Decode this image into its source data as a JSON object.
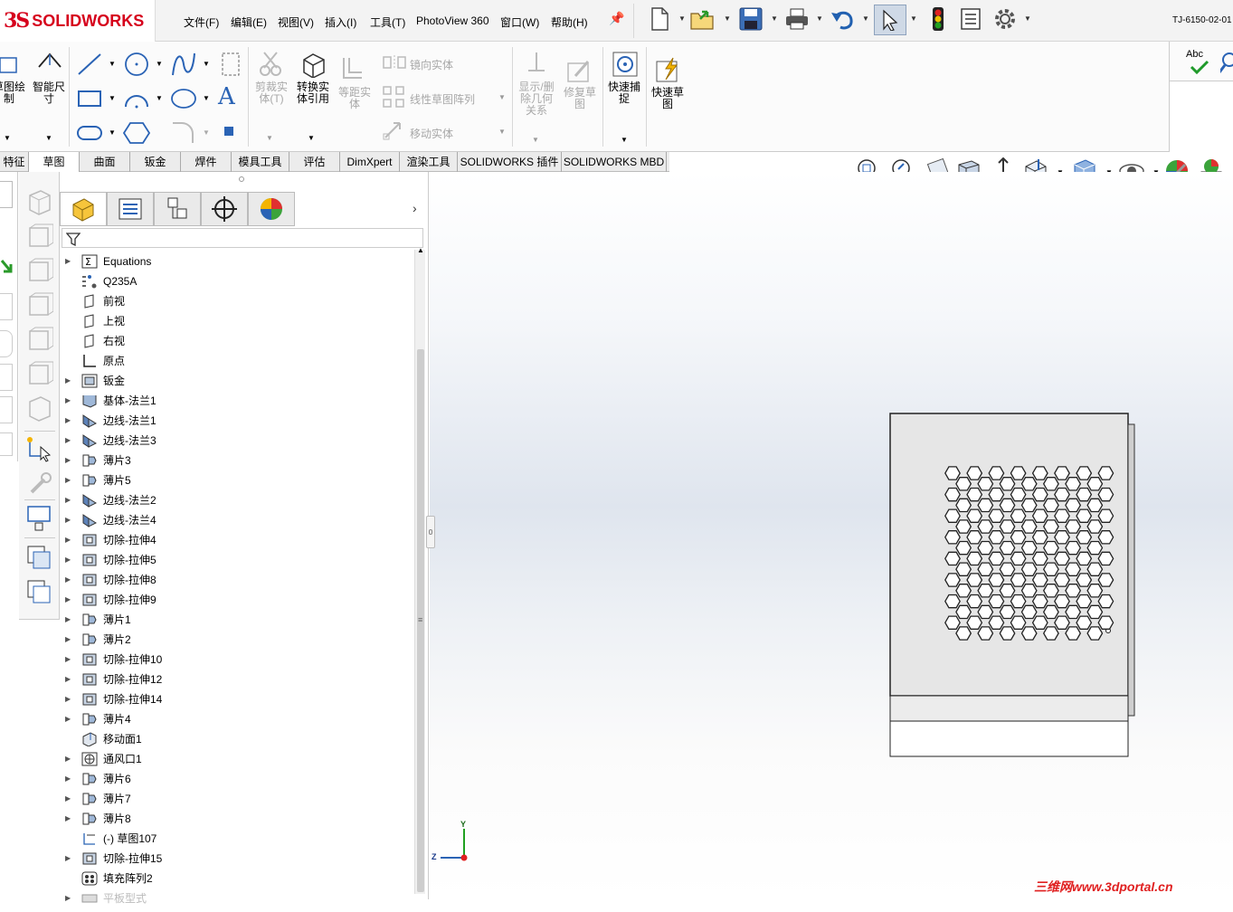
{
  "app": {
    "logo_prefix": "3S",
    "logo_name": "SOLIDWORKS",
    "document_title": "TJ-6150-02-01",
    "accent": "#d6001c"
  },
  "menu": [
    "文件(F)",
    "编辑(E)",
    "视图(V)",
    "插入(I)",
    "工具(T)",
    "PhotoView 360",
    "窗口(W)",
    "帮助(H)"
  ],
  "ribbon": {
    "sketch_draw": "草图绘制",
    "smart_dim": "智能尺寸",
    "trim": "剪裁实体(T)",
    "convert": "转换实体引用",
    "offset": "等距实体",
    "mirror": "镜向实体",
    "linear_pattern": "线性草图阵列",
    "move": "移动实体",
    "show_relations": "显示/删除几何关系",
    "repair": "修复草图",
    "quick_snap": "快速捕捉",
    "rapid_sketch": "快速草图",
    "abc": "Abc"
  },
  "tabs": [
    "特征",
    "草图",
    "曲面",
    "钣金",
    "焊件",
    "模具工具",
    "评估",
    "DimXpert",
    "渲染工具",
    "SOLIDWORKS 插件",
    "SOLIDWORKS MBD"
  ],
  "tree": [
    {
      "label": "Equations",
      "expand": true,
      "icon": "equations-icon"
    },
    {
      "label": "Q235A",
      "expand": false,
      "icon": "material-icon"
    },
    {
      "label": "前视",
      "expand": false,
      "icon": "plane-icon"
    },
    {
      "label": "上视",
      "expand": false,
      "icon": "plane-icon"
    },
    {
      "label": "右视",
      "expand": false,
      "icon": "plane-icon"
    },
    {
      "label": "原点",
      "expand": false,
      "icon": "origin-icon"
    },
    {
      "label": "钣金",
      "expand": true,
      "icon": "sheet-metal-icon"
    },
    {
      "label": "基体-法兰1",
      "expand": true,
      "icon": "base-flange-icon"
    },
    {
      "label": "边线-法兰1",
      "expand": true,
      "icon": "edge-flange-icon"
    },
    {
      "label": "边线-法兰3",
      "expand": true,
      "icon": "edge-flange-icon"
    },
    {
      "label": "薄片3",
      "expand": true,
      "icon": "tab-icon"
    },
    {
      "label": "薄片5",
      "expand": true,
      "icon": "tab-icon"
    },
    {
      "label": "边线-法兰2",
      "expand": true,
      "icon": "edge-flange-icon"
    },
    {
      "label": "边线-法兰4",
      "expand": true,
      "icon": "edge-flange-icon"
    },
    {
      "label": "切除-拉伸4",
      "expand": true,
      "icon": "cut-extrude-icon"
    },
    {
      "label": "切除-拉伸5",
      "expand": true,
      "icon": "cut-extrude-icon"
    },
    {
      "label": "切除-拉伸8",
      "expand": true,
      "icon": "cut-extrude-icon"
    },
    {
      "label": "切除-拉伸9",
      "expand": true,
      "icon": "cut-extrude-icon"
    },
    {
      "label": "薄片1",
      "expand": true,
      "icon": "tab-icon"
    },
    {
      "label": "薄片2",
      "expand": true,
      "icon": "tab-icon"
    },
    {
      "label": "切除-拉伸10",
      "expand": true,
      "icon": "cut-extrude-icon"
    },
    {
      "label": "切除-拉伸12",
      "expand": true,
      "icon": "cut-extrude-icon"
    },
    {
      "label": "切除-拉伸14",
      "expand": true,
      "icon": "cut-extrude-icon"
    },
    {
      "label": "薄片4",
      "expand": true,
      "icon": "tab-icon"
    },
    {
      "label": "移动面1",
      "expand": false,
      "icon": "move-face-icon"
    },
    {
      "label": "通风口1",
      "expand": true,
      "icon": "vent-icon"
    },
    {
      "label": "薄片6",
      "expand": true,
      "icon": "tab-icon"
    },
    {
      "label": "薄片7",
      "expand": true,
      "icon": "tab-icon"
    },
    {
      "label": "薄片8",
      "expand": true,
      "icon": "tab-icon"
    },
    {
      "label": "(-) 草图107",
      "expand": false,
      "icon": "sketch-icon"
    },
    {
      "label": "切除-拉伸15",
      "expand": true,
      "icon": "cut-extrude-icon"
    },
    {
      "label": "填充阵列2",
      "expand": false,
      "icon": "fill-pattern-icon"
    },
    {
      "label": "平板型式",
      "expand": true,
      "icon": "flat-pattern-icon"
    }
  ],
  "triad": {
    "y": "Y",
    "z": "Z"
  },
  "watermark": "三维网www.3dportal.cn"
}
